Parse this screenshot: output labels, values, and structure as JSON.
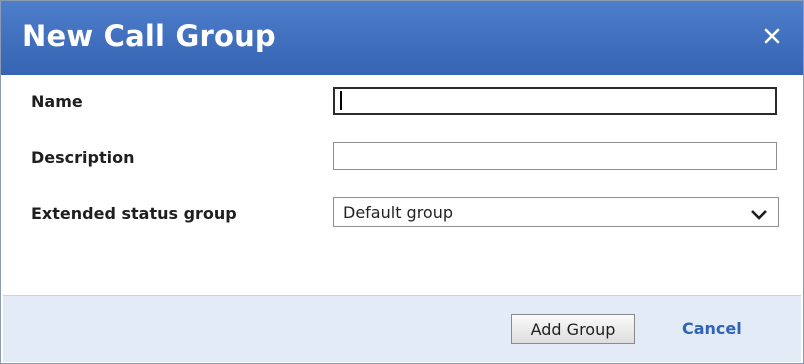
{
  "dialog": {
    "title": "New Call Group",
    "close_icon": "close-icon"
  },
  "form": {
    "name_label": "Name",
    "name_value": "",
    "description_label": "Description",
    "description_value": "",
    "status_group_label": "Extended status group",
    "status_group_value": "Default group",
    "status_group_icon": "chevron-down-icon"
  },
  "footer": {
    "add_label": "Add Group",
    "cancel_label": "Cancel"
  },
  "colors": {
    "titlebar": "#3f6fbd",
    "footer": "#e3ebf7",
    "link": "#2f63b6"
  }
}
